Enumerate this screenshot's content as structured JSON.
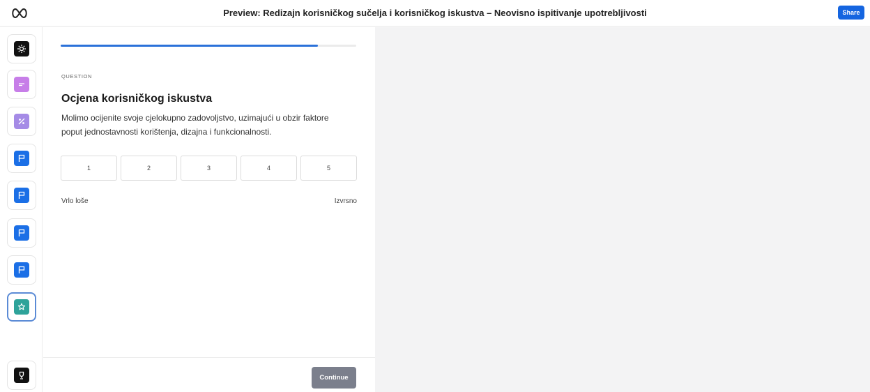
{
  "header": {
    "title": "Preview: Redizajn korisničkog sučelja i korisničkog iskustva – Neovisno ispitivanje upotrebljivosti",
    "share_label": "Share",
    "logo_icon": "infinity-logo-icon"
  },
  "sidebar": {
    "steps": [
      {
        "icon": "sun-icon",
        "color": "#111111"
      },
      {
        "icon": "text-icon",
        "color": "#c77ee8"
      },
      {
        "icon": "percent-icon",
        "color": "#a58be6"
      },
      {
        "icon": "flag-icon",
        "color": "#1b6fe6"
      },
      {
        "icon": "flag-icon",
        "color": "#1b6fe6"
      },
      {
        "icon": "flag-icon",
        "color": "#1b6fe6"
      },
      {
        "icon": "flag-icon",
        "color": "#1b6fe6"
      },
      {
        "icon": "star-icon",
        "color": "#2ea39a",
        "active": true
      },
      {
        "icon": "trophy-icon",
        "color": "#111111"
      }
    ]
  },
  "question": {
    "progress": 0.87,
    "label": "QUESTION",
    "title": "Ocjena korisničkog iskustva",
    "description": "Molimo ocijenite svoje cjelokupno zadovoljstvo, uzimajući u obzir faktore poput jednostavnosti korištenja, dizajna i funkcionalnosti.",
    "options": [
      "1",
      "2",
      "3",
      "4",
      "5"
    ],
    "low_label": "Vrlo loše",
    "high_label": "Izvrsno"
  },
  "footer": {
    "continue_label": "Continue"
  },
  "colors": {
    "accent": "#2b71d9",
    "share_button": "#1565e0",
    "continue_button": "#7b7f8c",
    "canvas_bg": "#f3f3f4"
  }
}
